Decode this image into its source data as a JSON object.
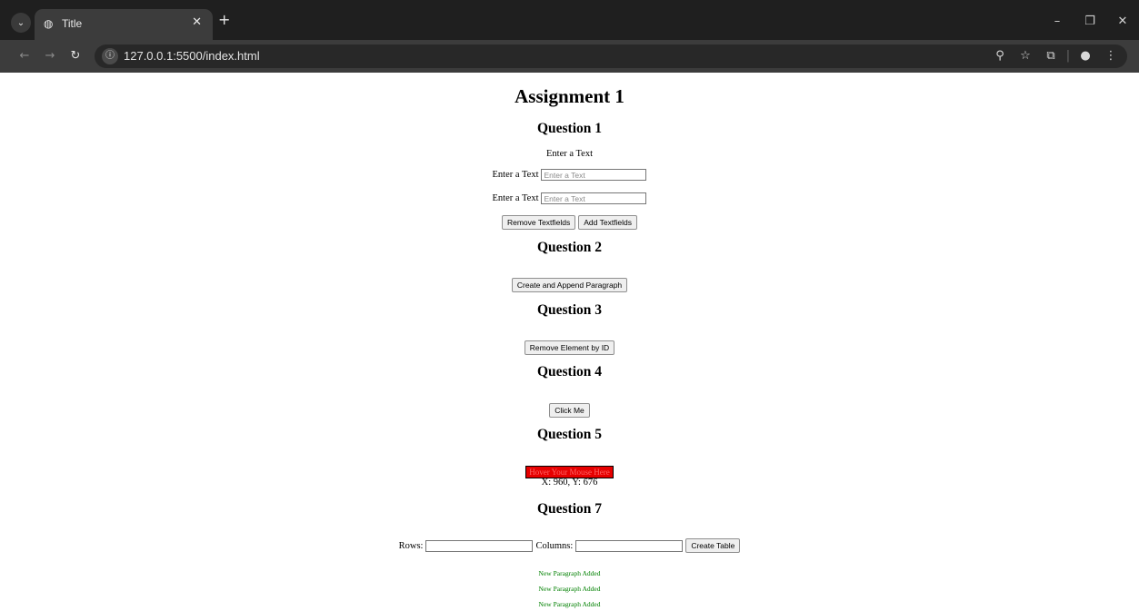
{
  "browser": {
    "tab_title": "Title",
    "url": "127.0.0.1:5500/index.html"
  },
  "page": {
    "title": "Assignment 1",
    "q1": {
      "heading": "Question 1",
      "subtitle": "Enter a Text",
      "fields": [
        {
          "label": "Enter a Text",
          "placeholder": "Enter a Text"
        },
        {
          "label": "Enter a Text",
          "placeholder": "Enter a Text"
        }
      ],
      "remove_button": "Remove Textfields",
      "add_button": "Add Textfields"
    },
    "q2": {
      "heading": "Question 2",
      "button": "Create and Append Paragraph"
    },
    "q3": {
      "heading": "Question 3",
      "button": "Remove Element by ID"
    },
    "q4": {
      "heading": "Question 4",
      "button": "Click Me"
    },
    "q5": {
      "heading": "Question 5",
      "hover_text": "Hover Your Mouse Here",
      "coords": "X: 960, Y: 676"
    },
    "q7": {
      "heading": "Question 7",
      "rows_label": "Rows:",
      "columns_label": "Columns:",
      "create_button": "Create Table"
    },
    "paragraphs": [
      "New Paragraph Added",
      "New Paragraph Added",
      "New Paragraph Added"
    ]
  }
}
